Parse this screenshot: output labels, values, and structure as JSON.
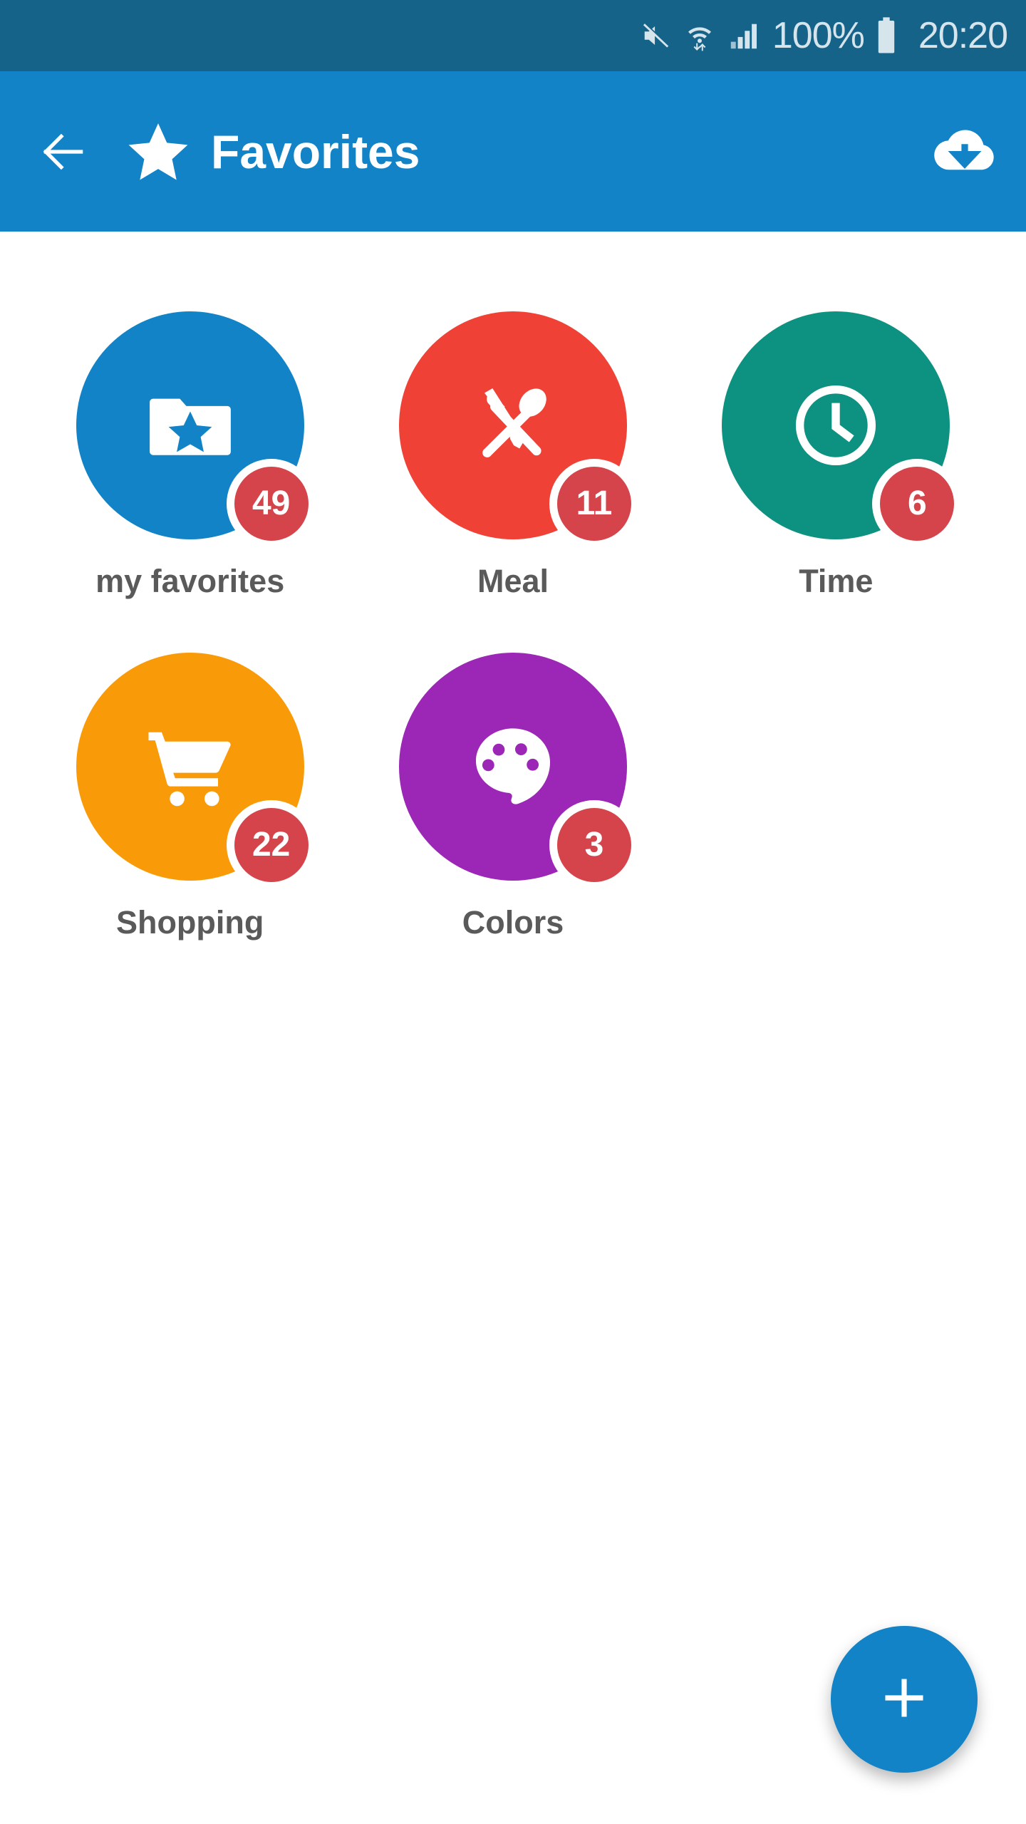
{
  "status_bar": {
    "background": "#16638A",
    "icons": [
      "mute-icon",
      "wifi-icon",
      "signal-icon",
      "battery-icon"
    ],
    "battery_percent": "100%",
    "clock": "20:20"
  },
  "app_bar": {
    "background": "#1283C6",
    "back_icon": "back-arrow-icon",
    "leading_icon": "star-icon",
    "title": "Favorites",
    "action_icon": "cloud-download-icon"
  },
  "content": {
    "tiles": [
      {
        "label": "my favorites",
        "badge": "49",
        "color": "#1283C6",
        "icon": "folder-star-icon"
      },
      {
        "label": "Meal",
        "badge": "11",
        "color": "#EF4136",
        "icon": "cutlery-icon"
      },
      {
        "label": "Time",
        "badge": "6",
        "color": "#0D9180",
        "icon": "clock-icon"
      },
      {
        "label": "Shopping",
        "badge": "22",
        "color": "#F99B09",
        "icon": "shopping-cart-icon"
      },
      {
        "label": "Colors",
        "badge": "3",
        "color": "#9C27B6",
        "icon": "palette-icon"
      }
    ],
    "badge_color": "#D4444A",
    "label_color": "#5a5a5a"
  },
  "fab": {
    "icon": "plus-icon",
    "color": "#1283C6"
  }
}
